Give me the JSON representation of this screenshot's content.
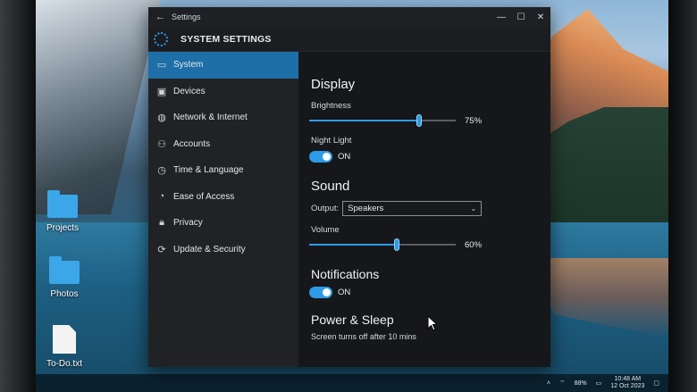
{
  "desktop": {
    "icons": [
      {
        "label": "Projects"
      },
      {
        "label": "Photos"
      },
      {
        "label": "To-Do.txt"
      }
    ]
  },
  "window": {
    "titlebar": {
      "back_icon": "back-arrow-icon",
      "title": "Settings"
    },
    "header": {
      "title": "SYSTEM SETTINGS"
    },
    "sidebar": {
      "items": [
        {
          "label": "System",
          "icon": "monitor-icon"
        },
        {
          "label": "Devices",
          "icon": "devices-icon"
        },
        {
          "label": "Network & Internet",
          "icon": "globe-icon"
        },
        {
          "label": "Accounts",
          "icon": "person-icon"
        },
        {
          "label": "Time & Language",
          "icon": "clock-icon"
        },
        {
          "label": "Ease of Access",
          "icon": "accessibility-icon"
        },
        {
          "label": "Privacy",
          "icon": "lock-icon"
        },
        {
          "label": "Update & Security",
          "icon": "refresh-icon"
        }
      ]
    },
    "content": {
      "display": {
        "heading": "Display",
        "brightness_label": "Brightness",
        "brightness_value": "75%",
        "brightness_fraction": 0.75,
        "nightlight_label": "Night Light",
        "nightlight_state": "ON"
      },
      "sound": {
        "heading": "Sound",
        "output_label": "Output:",
        "output_value": "Speakers",
        "volume_label": "Volume",
        "volume_value": "60%",
        "volume_fraction": 0.6
      },
      "notifications": {
        "heading": "Notifications",
        "state": "ON"
      },
      "power": {
        "heading": "Power & Sleep",
        "text": "Screen turns off after 10 mins"
      }
    }
  },
  "taskbar": {
    "battery": "88%",
    "time": "10:48 AM",
    "date": "12 Oct 2023"
  },
  "colors": {
    "accent": "#2e9be6",
    "sidebar_active": "#1e6fa8"
  }
}
